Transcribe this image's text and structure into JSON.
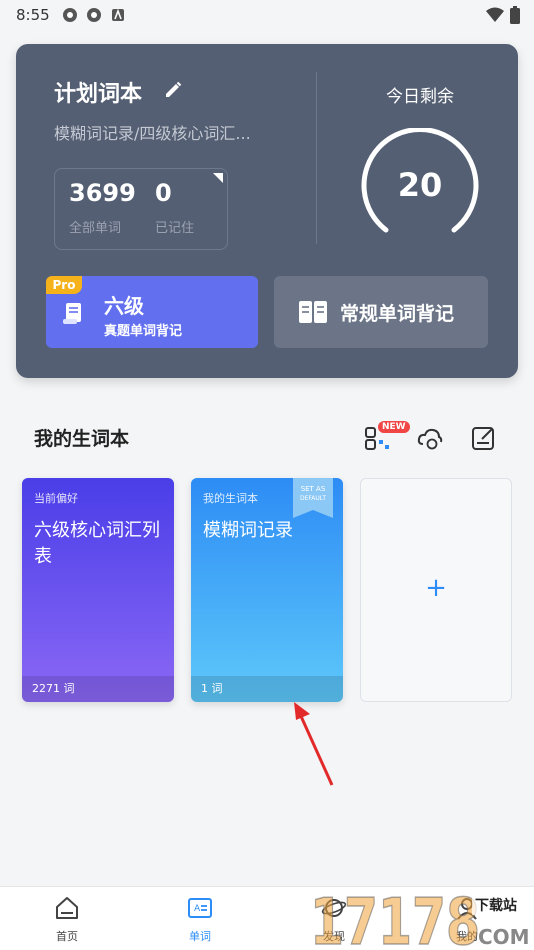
{
  "status_bar": {
    "time": "8:55"
  },
  "plan_card": {
    "title": "计划词本",
    "subtitle": "模糊词记录/四级核心词汇...",
    "total_words": "3699",
    "total_words_label": "全部单词",
    "remembered": "0",
    "remembered_label": "已记住",
    "remain_label": "今日剩余",
    "remain_count": "20",
    "cet6": {
      "badge": "Pro",
      "title": "六级",
      "subtitle": "真题单词背记"
    },
    "normal_button_label": "常规单词背记"
  },
  "vocab_section": {
    "title": "我的生词本",
    "new_badge": "NEW",
    "books": [
      {
        "tag": "当前偏好",
        "name": "六级核心词汇列表",
        "count": "2271 词"
      },
      {
        "tag": "我的生词本",
        "name": "模糊词记录",
        "count": "1 词",
        "ribbon": "SET AS DEFAULT"
      }
    ],
    "add_symbol": "+"
  },
  "tabbar": {
    "tabs": [
      {
        "label": "首页"
      },
      {
        "label": "单词"
      },
      {
        "label": "发现"
      },
      {
        "label": "我的"
      }
    ]
  },
  "watermark": {
    "digits": "17178",
    "text": "下载站",
    "sub": "COM"
  },
  "colors": {
    "card": "#545f73",
    "accent": "#2d8cf5",
    "cet6": "#6270f0",
    "pro": "#f5b21b"
  }
}
